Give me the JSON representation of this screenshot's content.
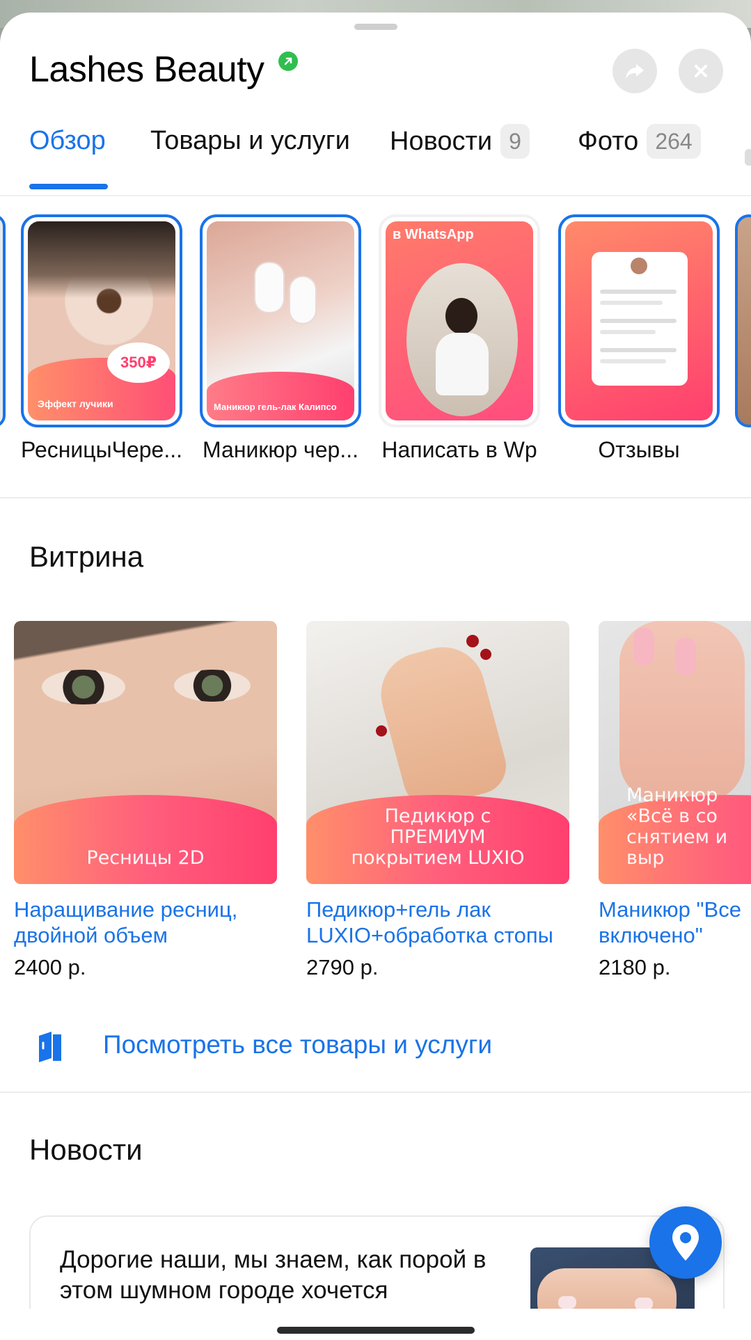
{
  "header": {
    "title": "Lashes Beauty"
  },
  "tabs": [
    {
      "label": "Обзор",
      "count": ""
    },
    {
      "label": "Товары и услуги",
      "count": ""
    },
    {
      "label": "Новости",
      "count": "9"
    },
    {
      "label": "Фото",
      "count": "264"
    }
  ],
  "stories": [
    {
      "caption": "РесницыЧере...",
      "badge": "350₽",
      "overlay": "Эффект лучики"
    },
    {
      "caption": "Маникюр чер...",
      "overlay": "Маникюр гель-лак Калипсо"
    },
    {
      "caption": "Написать в Wp",
      "overlay": "в WhatsApp"
    },
    {
      "caption": "Отзывы"
    }
  ],
  "showcase": {
    "title": "Витрина",
    "items": [
      {
        "name": "Наращивание ресниц, двойной объем",
        "price": "2400 р.",
        "overlay": "Ресницы 2D"
      },
      {
        "name": "Педикюр+гель лак LUXIO+обработка стопы",
        "price": "2790 р.",
        "overlay": "Педикюр с ПРЕМИУМ покрытием LUXIO"
      },
      {
        "name": "Маникюр \"Все включено\"",
        "price": "2180 р.",
        "overlay": "Маникюр «Всё в со снятием и выр"
      }
    ],
    "all_link": "Посмотреть все товары и услуги"
  },
  "news": {
    "title": "Новости",
    "text": "Дорогие наши, мы знаем, как порой в этом шумном городе хочется"
  },
  "colors": {
    "accent": "#1a73e8",
    "verified": "#2fbf4e",
    "promo_gradient_start": "#ff8f6a",
    "promo_gradient_end": "#ff3f6f"
  }
}
